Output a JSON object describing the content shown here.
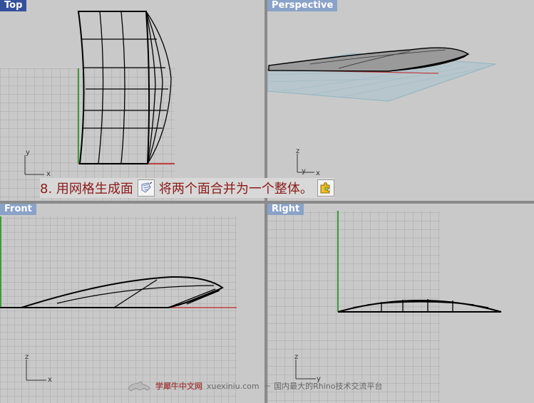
{
  "viewports": {
    "top": {
      "label": "Top",
      "axes": [
        "y",
        "x"
      ]
    },
    "perspective": {
      "label": "Perspective",
      "axes": [
        "z",
        "y",
        "x"
      ]
    },
    "front": {
      "label": "Front",
      "axes": [
        "z",
        "x"
      ]
    },
    "right": {
      "label": "Right",
      "axes": [
        "z",
        "y"
      ]
    }
  },
  "instruction": {
    "text_part1": "8. 用网格生成面",
    "text_part2": "将两个面合并为一个整体。",
    "icon1": "mesh-surface-icon",
    "icon2": "join-puzzle-icon"
  },
  "watermark": {
    "site_cn": "学犀牛中文网",
    "url": "xuexiniu.com",
    "tagline": "－ 国内最大的Rhino技术交流平台"
  },
  "colors": {
    "active_label": "#33519a",
    "inactive_label": "#8aa2c8",
    "viewport_bg": "#c9c9c9",
    "grid": "#a9a9a9",
    "x_axis": "#c04040",
    "y_axis": "#3c9a3c",
    "instruction_text": "#8b1a1a"
  }
}
